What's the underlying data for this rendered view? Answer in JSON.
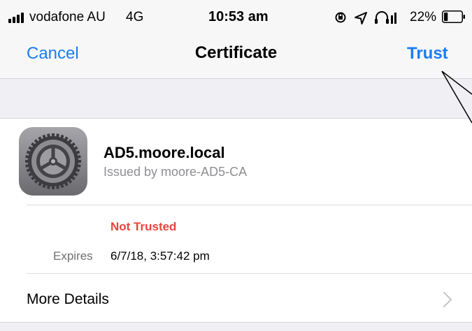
{
  "status_bar": {
    "carrier": "vodafone AU",
    "network": "4G",
    "time": "10:53 am",
    "battery_percent": "22%",
    "battery_level": 0.22,
    "icons": [
      "signal-bars-icon",
      "orientation-lock-icon",
      "location-arrow-icon",
      "headphones-icon",
      "battery-icon"
    ]
  },
  "nav": {
    "cancel_label": "Cancel",
    "title": "Certificate",
    "trust_label": "Trust"
  },
  "certificate": {
    "icon": "settings-gear-icon",
    "name": "AD5.moore.local",
    "issuer": "Issued by moore-AD5-CA",
    "trust_status": "Not Trusted",
    "expires_label": "Expires",
    "expires_value": "6/7/18, 3:57:42 pm"
  },
  "more_details": {
    "label": "More Details",
    "icon": "chevron-right-icon"
  },
  "colors": {
    "accent": "#1a7cf4",
    "warning": "#e8453c",
    "secondary_text": "#8e8e93",
    "bar_background": "#f7f7f7",
    "group_background": "#efeff4"
  }
}
